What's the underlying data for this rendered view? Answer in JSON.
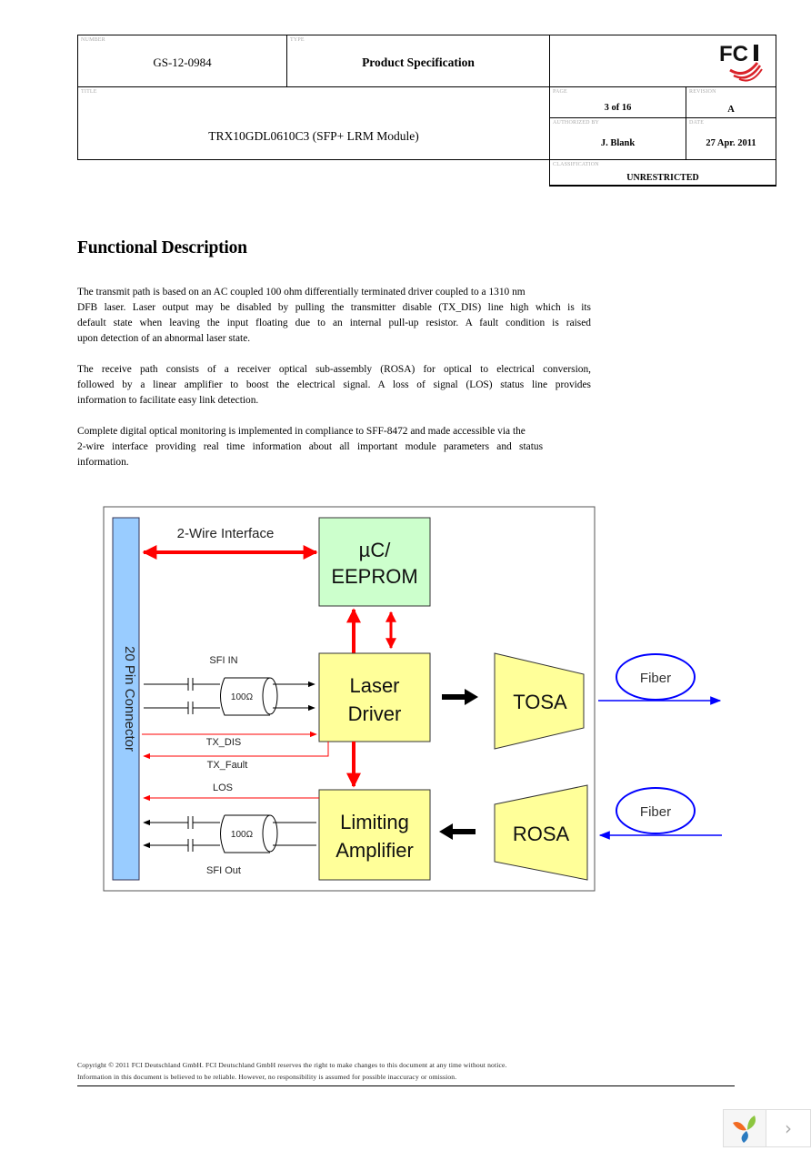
{
  "header": {
    "number_caption": "Number",
    "number": "GS-12-0984",
    "type_caption": "Type",
    "type": "Product Specification",
    "title_caption": "Title",
    "title": "TRX10GDL0610C3 (SFP+ LRM Module)",
    "logo_text": "FCI",
    "page_caption": "Page",
    "page": "3 of 16",
    "revision_caption": "Revision",
    "revision": "A",
    "authorized_caption": "Authorized by",
    "authorized_by": "J. Blank",
    "date_caption": "Date",
    "date": "27 Apr. 2011",
    "classification_caption": "Classification",
    "classification": "UNRESTRICTED"
  },
  "section": {
    "heading": "Functional Description",
    "paragraphs": [
      {
        "lines": [
          "The transmit path is based on an AC coupled 100 ohm differentially terminated driver coupled to a 1310 nm",
          "DFB laser. Laser output may be disabled by pulling the transmitter disable (TX_DIS) line high which is its",
          "default state when leaving the input floating due to an internal pull-up resistor. A fault condition is raised",
          "upon detection of an abnormal laser state."
        ]
      },
      {
        "lines": [
          "The receive path consists of a receiver optical sub-assembly (ROSA) for optical to electrical conversion,",
          "followed by a linear amplifier to boost the electrical signal. A loss of signal (LOS) status line provides",
          "information to facilitate easy link detection."
        ]
      },
      {
        "lines": [
          "Complete digital optical monitoring is implemented in compliance to SFF-8472 and made accessible via the",
          "2-wire interface providing real time information about all important module parameters and status",
          "information."
        ]
      }
    ]
  },
  "diagram": {
    "connector_label": "20 Pin Connector",
    "two_wire_label": "2-Wire Interface",
    "uc_label_1": "µC/",
    "uc_label_2": "EEPROM",
    "laser_label_1": "Laser",
    "laser_label_2": "Driver",
    "limiting_label_1": "Limiting",
    "limiting_label_2": "Amplifier",
    "tosa_label": "TOSA",
    "rosa_label": "ROSA",
    "fiber_tx_label": "Fiber",
    "fiber_rx_label": "Fiber",
    "sfi_in_label": "SFI IN",
    "sfi_out_label": "SFI Out",
    "impedance_in": "100Ω",
    "impedance_out": "100Ω",
    "tx_dis_label": "TX_DIS",
    "tx_fault_label": "TX_Fault",
    "los_label": "LOS",
    "colors": {
      "connector": "#99ccff",
      "uc_box": "#ccffcc",
      "yellow_box": "#ffff99",
      "signal_red": "#ff0000",
      "fiber_blue": "#0000ff"
    }
  },
  "footer": {
    "line1": "Copyright © 2011 FCI Deutschland GmbH. FCI Deutschland GmbH reserves the right to make changes to this document at any time without notice.",
    "line2": "Information in this document is believed to be reliable. However, no responsibility is assumed for possible inaccuracy or omission."
  },
  "viewer": {
    "next_label": "›"
  }
}
